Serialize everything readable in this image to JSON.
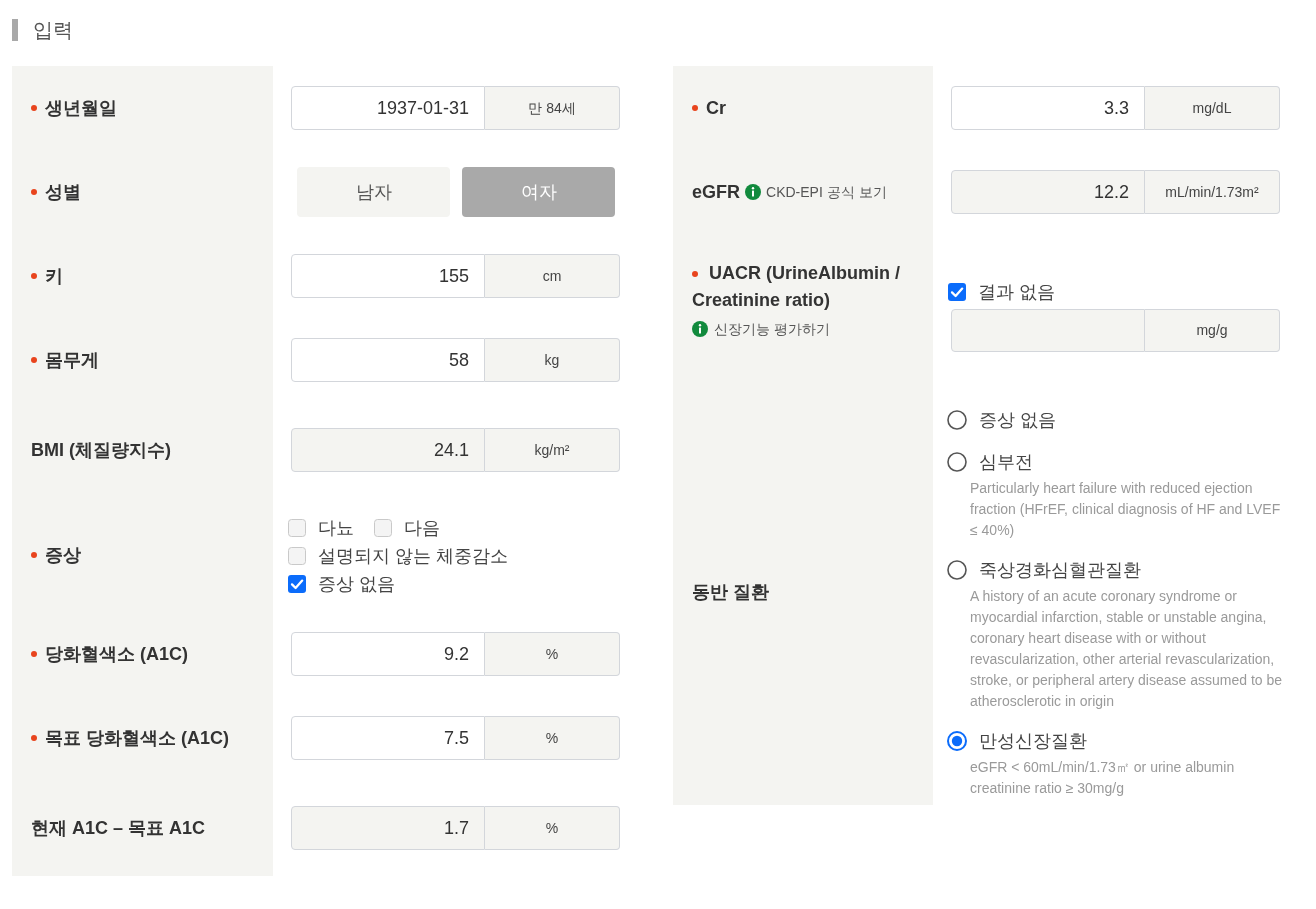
{
  "section_title": "입력",
  "left_fields": [
    {
      "kind": "input",
      "label": "생년월일",
      "required": true,
      "value": "1937-01-31",
      "unit": "만 84세",
      "readonly": false
    },
    {
      "kind": "toggle",
      "label": "성별",
      "required": true,
      "options": [
        {
          "label": "남자",
          "selected": false
        },
        {
          "label": "여자",
          "selected": true
        }
      ]
    },
    {
      "kind": "input",
      "label": "키",
      "required": true,
      "value": "155",
      "unit": "cm",
      "readonly": false
    },
    {
      "kind": "input",
      "label": "몸무게",
      "required": true,
      "value": "58",
      "unit": "kg",
      "readonly": false
    },
    {
      "kind": "input",
      "label": "BMI (체질량지수)",
      "required": false,
      "value": "24.1",
      "unit": "kg/m²",
      "readonly": true
    },
    {
      "kind": "checkboxes",
      "label": "증상",
      "required": true,
      "lines": [
        {
          "options": [
            {
              "label": "다뇨",
              "checked": false
            },
            {
              "label": "다음",
              "checked": false
            }
          ]
        },
        {
          "options": [
            {
              "label": "설명되지 않는 체중감소",
              "checked": false
            }
          ]
        },
        {
          "options": [
            {
              "label": "증상 없음",
              "checked": true
            }
          ]
        }
      ]
    },
    {
      "kind": "input",
      "label": "당화혈색소 (A1C)",
      "required": true,
      "value": "9.2",
      "unit": "%",
      "readonly": false
    },
    {
      "kind": "input",
      "label": "목표 당화혈색소 (A1C)",
      "required": true,
      "value": "7.5",
      "unit": "%",
      "readonly": false
    },
    {
      "kind": "input",
      "label": "현재 A1C – 목표 A1C",
      "required": false,
      "value": "1.7",
      "unit": "%",
      "readonly": true
    }
  ],
  "right_fields": [
    {
      "kind": "input",
      "label": "Cr",
      "required": true,
      "value": "3.3",
      "unit": "mg/dL",
      "readonly": false
    },
    {
      "kind": "input",
      "label": "eGFR",
      "required": false,
      "info_link": "CKD-EPI 공식 보기",
      "value": "12.2",
      "unit": "mL/min/1.73m²",
      "readonly": true
    },
    {
      "kind": "check_input",
      "label": "UACR (UrineAlbumin / Creatinine ratio)",
      "required": true,
      "info_link": "신장기능 평가하기",
      "checkbox": {
        "label": "결과 없음",
        "checked": true
      },
      "unit": "mg/g",
      "readonly": true
    },
    {
      "kind": "radios",
      "label": "동반 질환",
      "required": false,
      "options": [
        {
          "label": "증상 없음",
          "selected": false
        },
        {
          "label": "심부전",
          "selected": false,
          "description": "Particularly heart failure with reduced ejection fraction (HFrEF, clinical diagnosis of HF and LVEF ≤ 40%)"
        },
        {
          "label": "죽상경화심혈관질환",
          "selected": false,
          "description": "A history of an acute coronary syndrome or myocardial infarction, stable or unstable angina, coronary heart disease with or without revascularization, other arterial revascularization, stroke, or peripheral artery disease assumed to be atherosclerotic in origin"
        },
        {
          "label": "만성신장질환",
          "selected": true,
          "description": "eGFR < 60mL/min/1.73㎡ or urine albumin creatinine ratio ≥ 30mg/g"
        }
      ]
    }
  ]
}
